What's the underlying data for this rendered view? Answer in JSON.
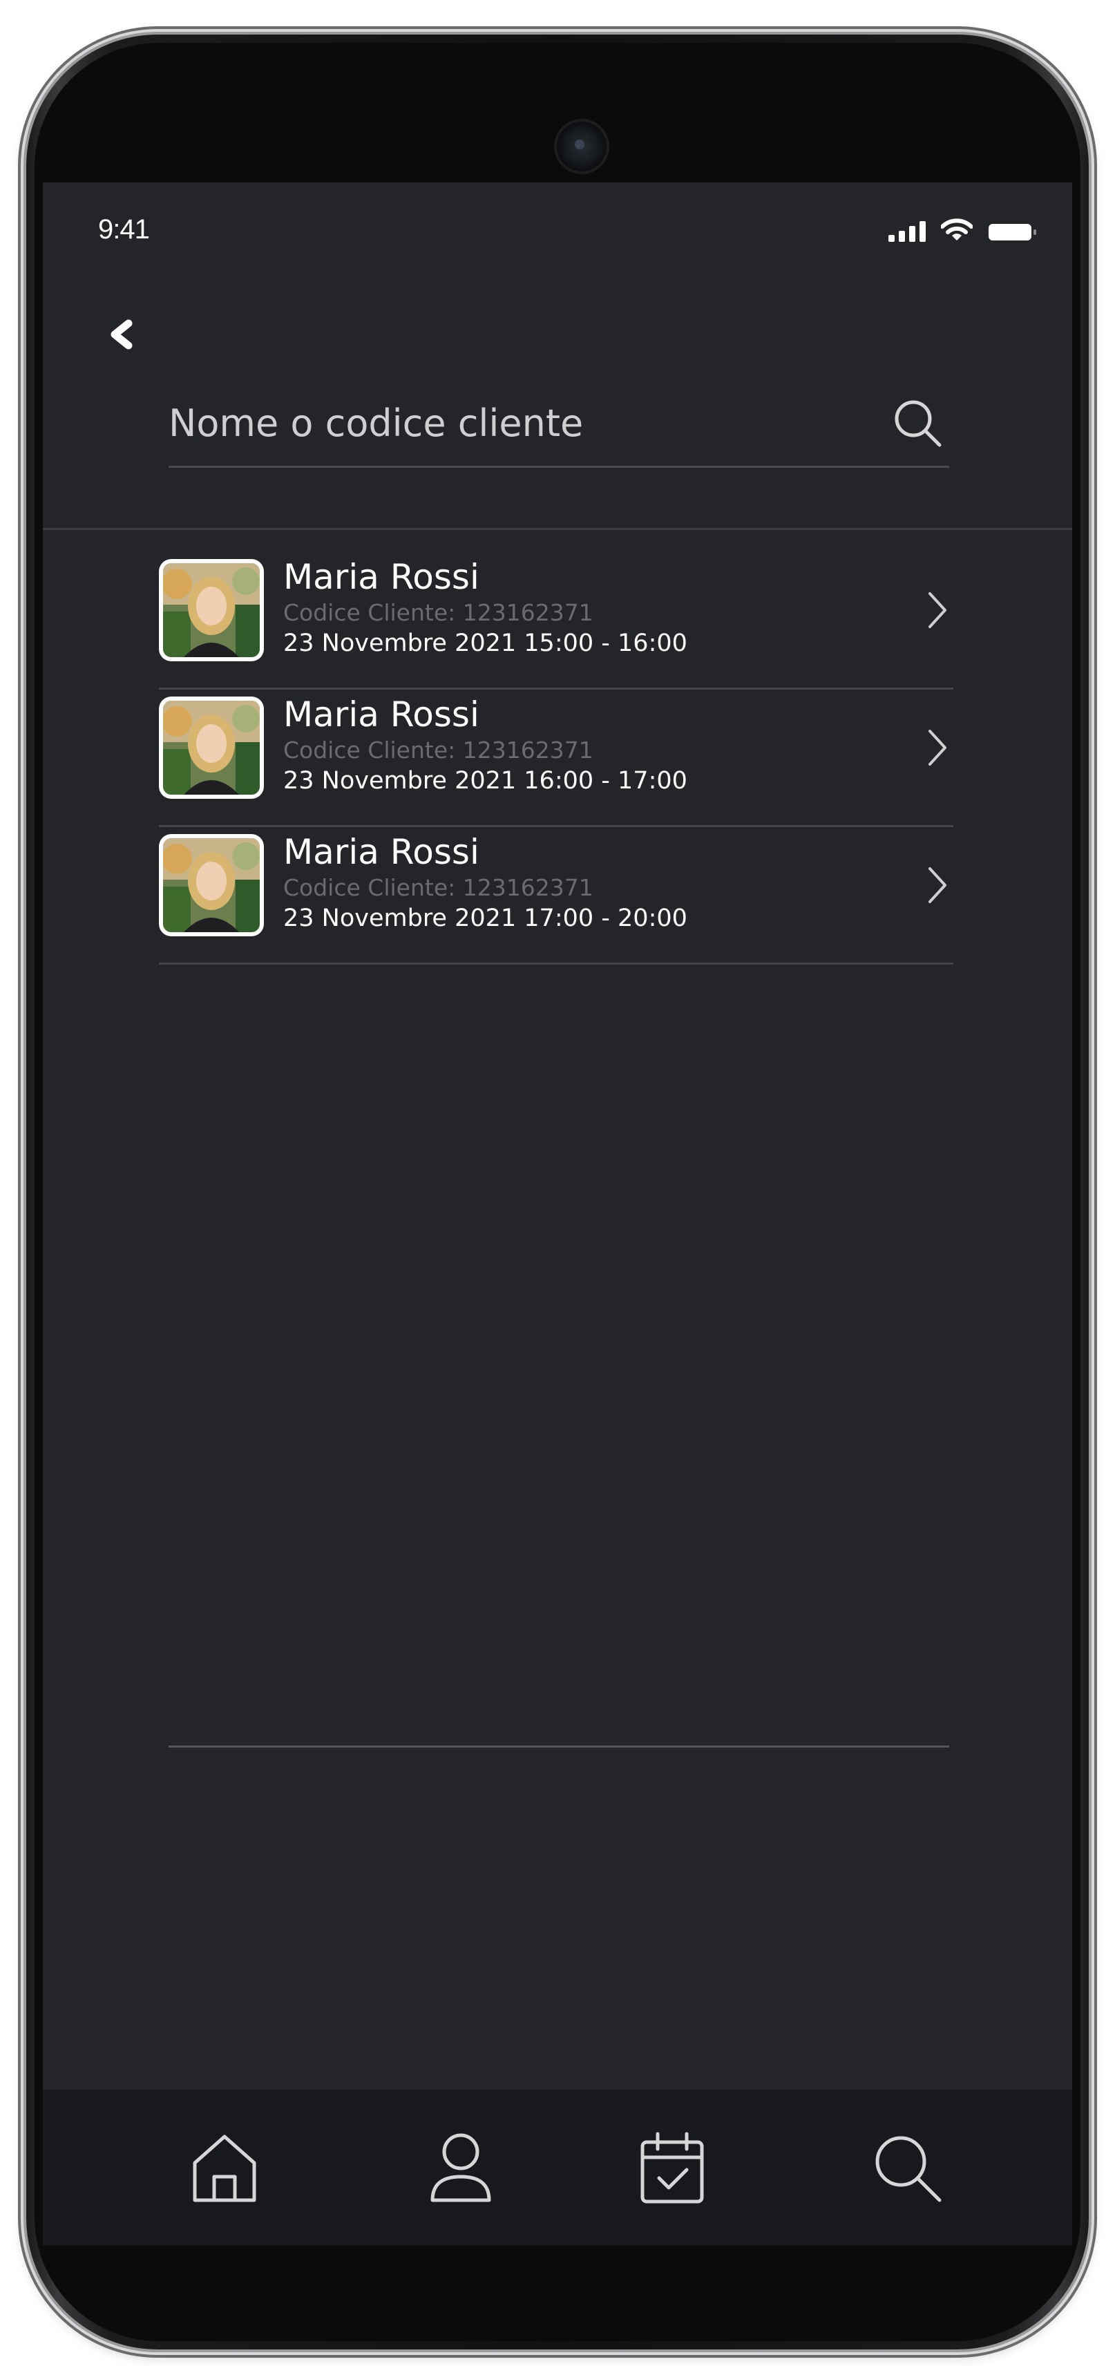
{
  "status_bar": {
    "time": "9:41",
    "icons": [
      "cellular-signal-icon",
      "wifi-icon",
      "battery-icon"
    ]
  },
  "header": {
    "back_icon": "chevron-left-icon",
    "search": {
      "placeholder": "Nome o codice cliente",
      "value": "",
      "icon": "search-icon"
    }
  },
  "clients": [
    {
      "name": "Maria Rossi",
      "code": "Codice Cliente: 123162371",
      "appointment": "23 Novembre 2021 15:00 - 16:00"
    },
    {
      "name": "Maria Rossi",
      "code": "Codice Cliente: 123162371",
      "appointment": "23 Novembre 2021 16:00 - 17:00"
    },
    {
      "name": "Maria Rossi",
      "code": "Codice Cliente: 123162371",
      "appointment": "23 Novembre 2021 17:00 - 20:00"
    }
  ],
  "tab_bar": {
    "tabs": [
      {
        "icon": "home-icon"
      },
      {
        "icon": "user-icon"
      },
      {
        "icon": "calendar-check-icon"
      },
      {
        "icon": "search-icon"
      }
    ]
  },
  "colors": {
    "screen_background": "#242529",
    "tab_bar_background": "#18191d",
    "primary_text": "#ffffff",
    "secondary_text": "#6a6b70",
    "divider": "#45464b"
  }
}
